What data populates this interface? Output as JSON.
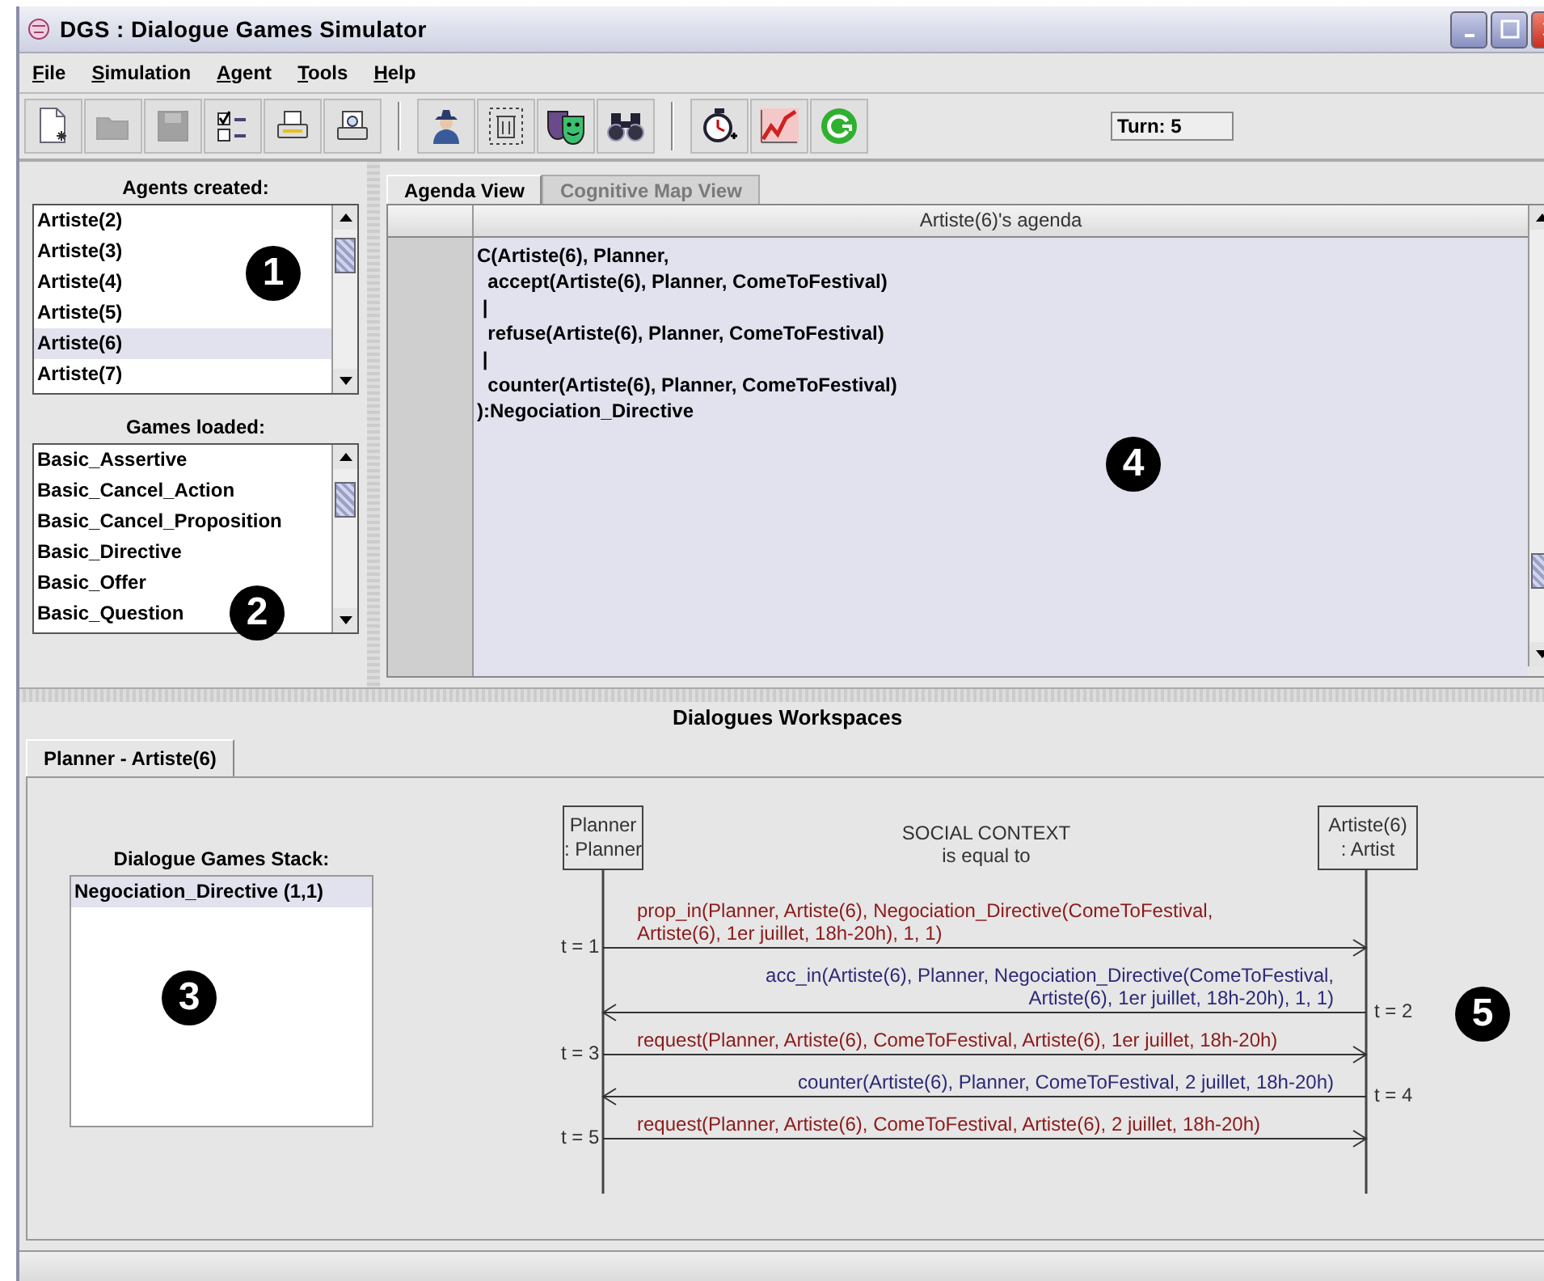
{
  "window": {
    "title": "DGS : Dialogue Games Simulator"
  },
  "menu": [
    "File",
    "Simulation",
    "Agent",
    "Tools",
    "Help"
  ],
  "toolbar": [
    [
      {
        "kind": "new",
        "disabled": false
      },
      {
        "kind": "open",
        "disabled": true
      },
      {
        "kind": "save",
        "disabled": true
      },
      {
        "kind": "checklist",
        "disabled": false
      },
      {
        "kind": "print",
        "disabled": false
      },
      {
        "kind": "preview",
        "disabled": false
      }
    ],
    [
      {
        "kind": "agent",
        "disabled": false
      },
      {
        "kind": "trash",
        "disabled": false
      },
      {
        "kind": "masks",
        "disabled": false
      },
      {
        "kind": "binoculars",
        "disabled": false
      }
    ],
    [
      {
        "kind": "stopwatch",
        "disabled": false
      },
      {
        "kind": "chart",
        "disabled": false
      },
      {
        "kind": "refresh",
        "disabled": false
      }
    ]
  ],
  "turn": "Turn: 5",
  "agents": {
    "title": "Agents created:",
    "items": [
      {
        "label": "Artiste(2)",
        "selected": false
      },
      {
        "label": "Artiste(3)",
        "selected": false
      },
      {
        "label": "Artiste(4)",
        "selected": false
      },
      {
        "label": "Artiste(5)",
        "selected": false
      },
      {
        "label": "Artiste(6)",
        "selected": true
      },
      {
        "label": "Artiste(7)",
        "selected": false
      }
    ]
  },
  "games": {
    "title": "Games loaded:",
    "items": [
      {
        "label": "Basic_Assertive",
        "selected": false
      },
      {
        "label": "Basic_Cancel_Action",
        "selected": false
      },
      {
        "label": "Basic_Cancel_Proposition",
        "selected": false
      },
      {
        "label": "Basic_Directive",
        "selected": false
      },
      {
        "label": "Basic_Offer",
        "selected": false
      },
      {
        "label": "Basic_Question",
        "selected": false
      }
    ]
  },
  "view_tabs": [
    {
      "label": "Agenda View",
      "selected": true,
      "disabled": false
    },
    {
      "label": "Cognitive Map View",
      "selected": false,
      "disabled": true
    }
  ],
  "agenda": {
    "header": "Artiste(6)'s agenda",
    "lines": [
      "C(Artiste(6), Planner,",
      "  accept(Artiste(6), Planner, ComeToFestival)",
      " |",
      "  refuse(Artiste(6), Planner, ComeToFestival)",
      " |",
      "  counter(Artiste(6), Planner, ComeToFestival)",
      "):Negociation_Directive"
    ]
  },
  "workspaces": {
    "title": "Dialogues Workspaces",
    "tabs": [
      {
        "label": "Planner - Artiste(6)",
        "selected": true
      }
    ],
    "stack": {
      "title": "Dialogue Games Stack:",
      "items": [
        {
          "label": "Negociation_Directive  (1,1)",
          "selected": true
        }
      ]
    },
    "diagram": {
      "left": [
        "Planner",
        ": Planner"
      ],
      "right": [
        "Artiste(6)",
        ": Artist"
      ],
      "context": [
        "SOCIAL CONTEXT",
        "is equal to"
      ],
      "messages": [
        {
          "kind": "to_right",
          "time": "t = 1",
          "color": "#8b1a1a",
          "lines": [
            "prop_in(Planner, Artiste(6), Negociation_Directive(ComeToFestival,",
            "Artiste(6), 1er juillet, 18h-20h), 1, 1)"
          ]
        },
        {
          "kind": "to_left",
          "time": "t = 2",
          "color": "#2a2a78",
          "lines": [
            "acc_in(Artiste(6), Planner, Negociation_Directive(ComeToFestival,",
            "Artiste(6), 1er juillet, 18h-20h), 1, 1)"
          ]
        },
        {
          "kind": "to_right",
          "time": "t = 3",
          "color": "#8b1a1a",
          "lines": [
            "request(Planner, Artiste(6), ComeToFestival, Artiste(6), 1er juillet, 18h-20h)"
          ]
        },
        {
          "kind": "to_left",
          "time": "t = 4",
          "color": "#2a2a78",
          "lines": [
            "counter(Artiste(6), Planner, ComeToFestival, 2 juillet, 18h-20h)"
          ]
        },
        {
          "kind": "to_right",
          "time": "t = 5",
          "color": "#8b1a1a",
          "lines": [
            "request(Planner, Artiste(6), ComeToFestival, Artiste(6), 2 juillet, 18h-20h)"
          ]
        }
      ]
    }
  },
  "callouts": [
    "1",
    "2",
    "3",
    "4",
    "5"
  ]
}
